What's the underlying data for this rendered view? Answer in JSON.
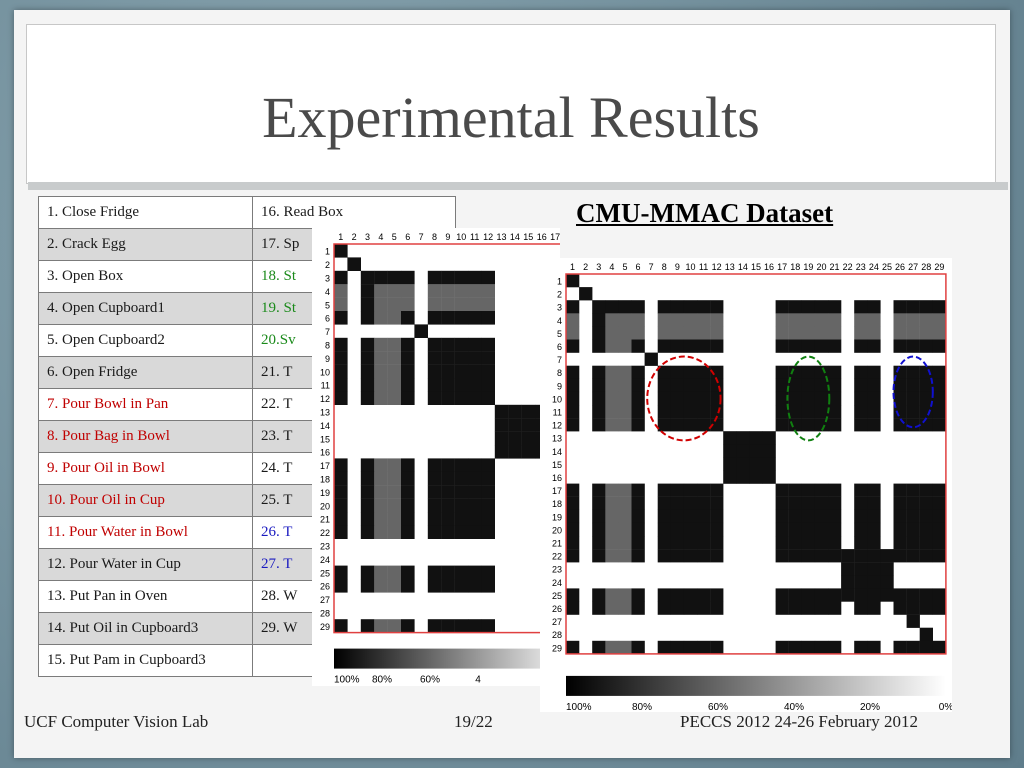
{
  "title": "Experimental Results",
  "dataset_title": "CMU-MMAC Dataset",
  "table": {
    "rows": [
      [
        {
          "text": "1.  Close Fridge",
          "color": "k"
        },
        {
          "text": "16. Read Box",
          "color": "k"
        }
      ],
      [
        {
          "text": "2. Crack Egg",
          "color": "k"
        },
        {
          "text": "17. Sp",
          "color": "k"
        }
      ],
      [
        {
          "text": "3. Open Box",
          "color": "k"
        },
        {
          "text": "18. St",
          "color": "g"
        }
      ],
      [
        {
          "text": "4. Open Cupboard1",
          "color": "k"
        },
        {
          "text": "19. St",
          "color": "g"
        }
      ],
      [
        {
          "text": "5. Open Cupboard2",
          "color": "k"
        },
        {
          "text": "20.Sv",
          "color": "g"
        }
      ],
      [
        {
          "text": "6. Open Fridge",
          "color": "k"
        },
        {
          "text": "21. T",
          "color": "k"
        }
      ],
      [
        {
          "text": "7. Pour Bowl in Pan",
          "color": "r"
        },
        {
          "text": "22. T",
          "color": "k"
        }
      ],
      [
        {
          "text": "8. Pour Bag in Bowl",
          "color": "r"
        },
        {
          "text": "23. T",
          "color": "k"
        }
      ],
      [
        {
          "text": "9. Pour Oil in Bowl",
          "color": "r"
        },
        {
          "text": "24. T",
          "color": "k"
        }
      ],
      [
        {
          "text": "10. Pour Oil in Cup",
          "color": "r"
        },
        {
          "text": "25. T",
          "color": "k"
        }
      ],
      [
        {
          "text": "11. Pour Water in Bowl",
          "color": "r"
        },
        {
          "text": "26. T",
          "color": "b"
        }
      ],
      [
        {
          "text": "12. Pour Water in Cup",
          "color": "k"
        },
        {
          "text": "27. T",
          "color": "b"
        }
      ],
      [
        {
          "text": "13. Put Pan in Oven",
          "color": "k"
        },
        {
          "text": "28. W",
          "color": "k"
        }
      ],
      [
        {
          "text": "14. Put Oil in Cupboard3",
          "color": "k"
        },
        {
          "text": "29. W",
          "color": "k"
        }
      ],
      [
        {
          "text": "15. Put Pam in Cupboard3",
          "color": "k"
        },
        {
          "text": "",
          "color": "k"
        }
      ]
    ]
  },
  "matrix_back": {
    "size": 29,
    "colorbar_labels": [
      "100%",
      "80%",
      "60%",
      "4"
    ]
  },
  "matrix_front": {
    "size": 29,
    "colorbar_labels": [
      "100%",
      "80%",
      "60%",
      "40%",
      "20%",
      "0%"
    ],
    "highlight_colors": [
      "#d00000",
      "#108010",
      "#1010d0"
    ]
  },
  "footer": {
    "left": "UCF Computer Vision Lab",
    "center": "19/22",
    "right": "PECCS 2012 24-26 February 2012"
  }
}
